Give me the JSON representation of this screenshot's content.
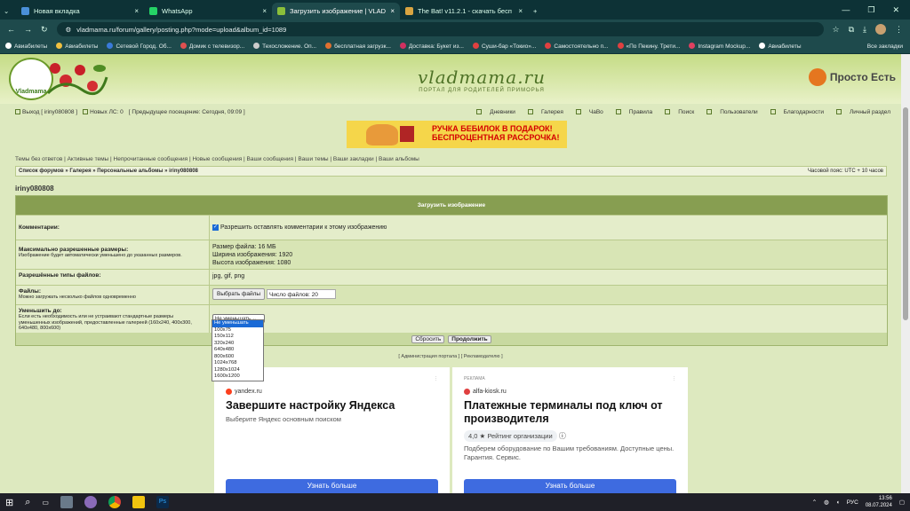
{
  "browser": {
    "tabs": [
      {
        "title": "Новая вкладка",
        "color": "#4a90d9"
      },
      {
        "title": "WhatsApp",
        "color": "#25d366"
      },
      {
        "title": "Загрузить изображение | VLAD",
        "color": "#8bbf3a",
        "active": true
      },
      {
        "title": "The Bat! v11.2.1 - скачать бесп",
        "color": "#d9a441"
      }
    ],
    "url": "vladmama.ru/forum/gallery/posting.php?mode=upload&album_id=1089",
    "bookmarks": [
      {
        "label": "Авиабилеты",
        "color": "#ffffff"
      },
      {
        "label": "Авиабилеты",
        "color": "#f0c040"
      },
      {
        "label": "Сетевой Город. Об...",
        "color": "#3a7ad9"
      },
      {
        "label": "Домик с телевизор...",
        "color": "#e05050"
      },
      {
        "label": "Техосложение. Оп...",
        "color": "#cccccc"
      },
      {
        "label": "бесплатная загрузк...",
        "color": "#e07030"
      },
      {
        "label": "Доставка: Букет из...",
        "color": "#d03060"
      },
      {
        "label": "Суши-бар «Токио»...",
        "color": "#e04040"
      },
      {
        "label": "Самостоятельно п...",
        "color": "#e04040"
      },
      {
        "label": "«По Пекину. Трети...",
        "color": "#e04040"
      },
      {
        "label": "Instagram Mockup...",
        "color": "#e04060"
      },
      {
        "label": "Авиабилеты",
        "color": "#ffffff"
      }
    ],
    "all_bookmarks": "Все закладки"
  },
  "site": {
    "logo_text": "Vladmama",
    "brand": "vladmama.ru",
    "brand_sub": "ПОРТАЛ ДЛЯ РОДИТЕЛЕЙ ПРИМОРЬЯ",
    "partner": "Просто Есть",
    "userbar_left": [
      "Выход [ iriny080808 ]",
      "Новых ЛС: 0",
      "[ Предыдущее посещение: Сегодня, 09:09 ]"
    ],
    "userbar_right": [
      "Дневники",
      "Галерея",
      "ЧаВо",
      "Правила",
      "Поиск",
      "Пользователи",
      "Благодарности",
      "Личный раздел"
    ],
    "banner_line1": "РУЧКА БЕБИЛОК В ПОДАРОК!",
    "banner_line2": "БЕСПРОЦЕНТНАЯ РАССРОЧКА!",
    "quick_links": "Темы без ответов | Активные темы | Непрочитанные сообщения | Новые сообщения | Ваши сообщения | Ваши темы | Ваши закладки | Ваши альбомы",
    "breadcrumb": "Список форумов » Галерея » Персональные альбомы » iriny080808",
    "timezone": "Часовой пояс: UTC + 10 часов",
    "username": "iriny080808"
  },
  "form": {
    "title": "Загрузить изображение",
    "comments_label": "Комментарии:",
    "comments_value": "Разрешить оставлять комментарии к этому изображению",
    "maxsize_label": "Максимально разрешенные размеры:",
    "maxsize_hint": "Изображение будет автоматически уменьшено до указанных размеров.",
    "maxsize_values": [
      "Размер файла: 16 МБ",
      "Ширина изображения: 1920",
      "Высота изображения: 1080"
    ],
    "types_label": "Разрешённые типы файлов:",
    "types_value": "jpg, gif, png",
    "files_label": "Файлы:",
    "files_hint": "Можно загружать несколько файлов одновременно",
    "browse_button": "Выбрать файлы",
    "files_count": "Число файлов: 20",
    "resize_label": "Уменьшить до:",
    "resize_hint": "Если есть необходимость или не устраивают стандартные размеры уменьшенных изображений, предоставленные галереей (160x240, 400x300, 640x480, 800x600)",
    "resize_selected": "Не уменьшать",
    "resize_options": [
      "Не уменьшать",
      "100x75",
      "150x112",
      "320x240",
      "640x480",
      "800x600",
      "1024x768",
      "1280x1024",
      "1600x1200"
    ],
    "reset_button": "Сбросить",
    "submit_button": "Продолжить"
  },
  "footer_links": "[ Администрация портала ] [ Рекламодателю ]",
  "ads": [
    {
      "tag": "",
      "source": "yandex.ru",
      "icon_color": "#fc3f1d",
      "title": "Завершите настройку Яндекса",
      "text": "Выберите Яндекс основным поиском",
      "cta": "Узнать больше"
    },
    {
      "tag": "РЕКЛАМА",
      "source": "alfa-kiosk.ru",
      "icon_color": "#e04040",
      "title": "Платежные терминалы под ключ от производителя",
      "rating": "4,0 ★ Рейтинг организации",
      "text": "Подберем оборудование по Вашим требованиям. Доступные цены. Гарантия. Сервис.",
      "cta": "Узнать больше"
    }
  ],
  "taskbar": {
    "lang": "РУС",
    "time": "13:56",
    "date": "08.07.2024"
  }
}
